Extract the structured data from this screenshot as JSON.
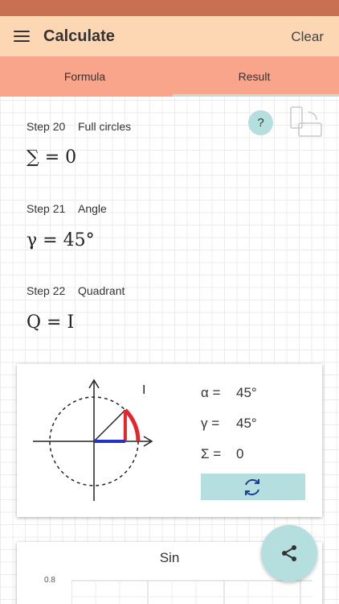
{
  "app": {
    "title": "Calculate",
    "clear_label": "Clear"
  },
  "tabs": [
    {
      "label": "Formula"
    },
    {
      "label": "Result"
    }
  ],
  "help": {
    "label": "?"
  },
  "steps": [
    {
      "number": "Step 20",
      "title": "Full circles",
      "formula": "∑ = 0"
    },
    {
      "number": "Step 21",
      "title": "Angle",
      "formula": "γ = 45°"
    },
    {
      "number": "Step 22",
      "title": "Quadrant",
      "formula": "Q = I"
    }
  ],
  "unit_circle": {
    "quadrant_label": "I",
    "angle_deg": 45,
    "values": [
      {
        "key": "α =",
        "value": "45°"
      },
      {
        "key": "γ =",
        "value": "45°"
      },
      {
        "key": "Σ =",
        "value": "0"
      }
    ]
  },
  "chart": {
    "title": "Sin",
    "tick_label": "0.8"
  },
  "colors": {
    "status_bar": "#c96f52",
    "app_bar": "#fdd6b3",
    "tab_bar": "#f9a58c",
    "accent": "#b5dede",
    "arc": "#e8232a",
    "cosine": "#2233cc"
  },
  "icons": [
    "menu-icon",
    "rotate-device-icon",
    "refresh-icon",
    "share-icon"
  ]
}
